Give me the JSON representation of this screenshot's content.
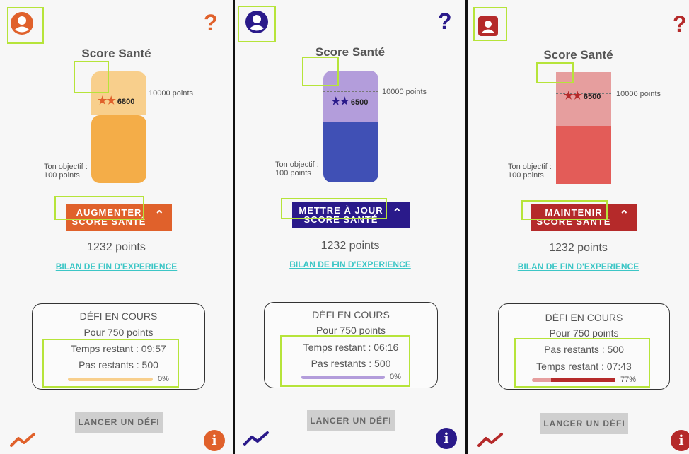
{
  "panels": [
    {
      "accent": "#e0612b",
      "bar_top": "#f8cf8c",
      "bar_bottom": "#f4ad48",
      "title": "Score Santé",
      "level_label": "10000 points",
      "goal_label_1": "Ton objectif :",
      "goal_label_2": "100 points",
      "score": "6800",
      "star_color": "#e0612b",
      "button_line1": "AUGMENTER",
      "button_line2": "SCORE SANTÉ",
      "button_color": "#e0612b",
      "points": "1232 points",
      "link": "BILAN DE FIN D'EXPERIENCE",
      "card_title": "DÉFI EN COURS",
      "card_reward": "Pour 750 points",
      "card_line1": "Temps restant : 09:57",
      "card_line2": "Pas restants : 500",
      "progress_pct": "0%",
      "progress_value": 0,
      "progress_track": "#f8cf8c",
      "progress_fill": "#e0612b",
      "launch": "LANCER UN DÉFI",
      "help": "?",
      "info": "i",
      "avatar_icon": "user-circle-icon",
      "trend_icon": "trend-line-icon"
    },
    {
      "accent": "#2a1a8a",
      "bar_top": "#b39ddb",
      "bar_bottom": "#4050b5",
      "title": "Score Santé",
      "level_label": "10000 points",
      "goal_label_1": "Ton objectif :",
      "goal_label_2": "100 points",
      "score": "6500",
      "star_color": "#2a1a8a",
      "button_line1": "METTRE À JOUR",
      "button_line2": "SCORE SANTÉ",
      "button_color": "#2a1a8a",
      "points": "1232 points",
      "link": "BILAN DE FIN D'EXPERIENCE",
      "card_title": "DÉFI EN COURS",
      "card_reward": "Pour 750 points",
      "card_line1": "Temps restant : 06:16",
      "card_line2": "Pas restants : 500",
      "progress_pct": "0%",
      "progress_value": 0,
      "progress_track": "#b39ddb",
      "progress_fill": "#2a1a8a",
      "launch": "LANCER UN DÉFI",
      "help": "?",
      "info": "i",
      "avatar_icon": "user-circle-icon",
      "trend_icon": "trend-line-icon"
    },
    {
      "accent": "#b52a2a",
      "bar_top": "#e69e9e",
      "bar_bottom": "#e35c58",
      "title": "Score Santé",
      "level_label": "10000 points",
      "goal_label_1": "Ton objectif :",
      "goal_label_2": "100 points",
      "score": "6500",
      "star_color": "#b52a2a",
      "button_line1": "MAINTENIR",
      "button_line2": "SCORE SANTÉ",
      "button_color": "#b52a2a",
      "points": "1232 points",
      "link": "BILAN DE FIN D'EXPERIENCE",
      "card_title": "DÉFI EN COURS",
      "card_reward": "Pour 750 points",
      "card_line1": "Pas restants : 500",
      "card_line2": "Temps restant : 07:43",
      "progress_pct": "77%",
      "progress_value": 0.77,
      "progress_track": "#e69e9e",
      "progress_fill": "#b52a2a",
      "launch": "LANCER UN DÉFI",
      "help": "?",
      "info": "i",
      "avatar_icon": "user-square-icon",
      "trend_icon": "trend-line-icon"
    }
  ]
}
